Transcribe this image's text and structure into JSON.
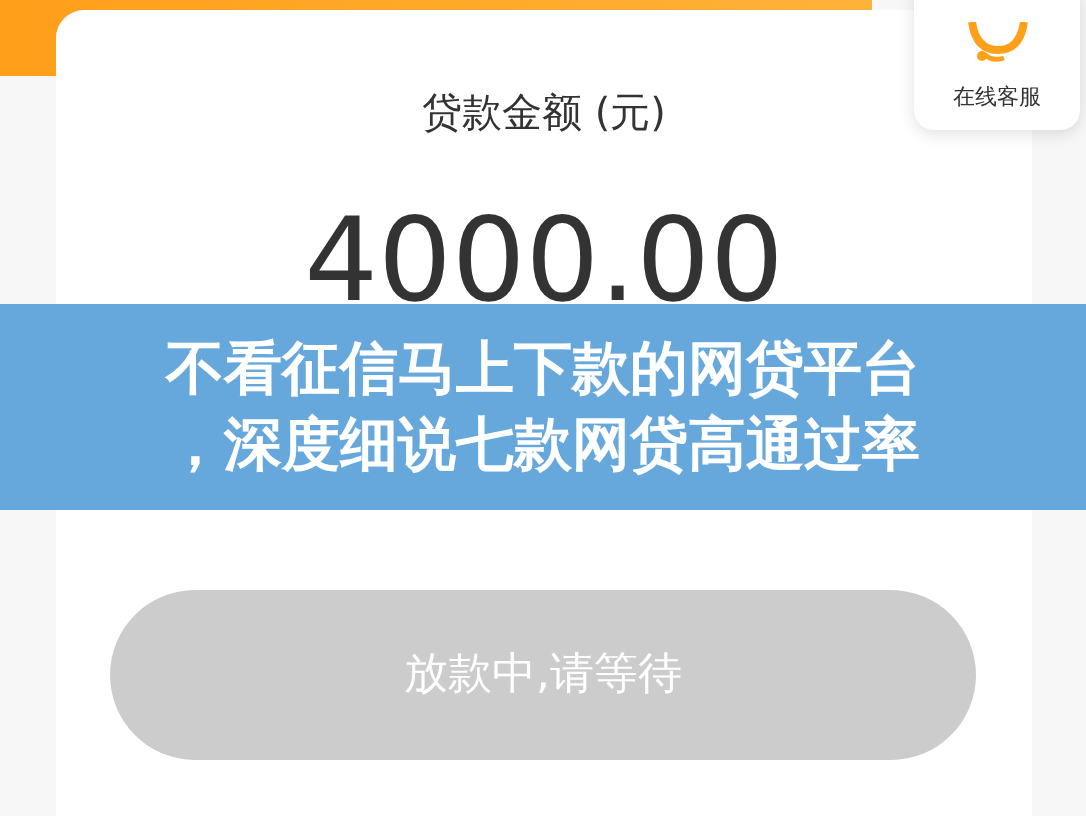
{
  "loan_card": {
    "label": "贷款金额 (元)",
    "amount": "4000.00"
  },
  "customer_service": {
    "label": "在线客服"
  },
  "banner": {
    "lines": [
      "不看征信马上下款的网贷平台",
      "，深度细说七款网贷高通过率"
    ]
  },
  "action_button": {
    "label": "放款中,请等待",
    "disabled": true
  }
}
